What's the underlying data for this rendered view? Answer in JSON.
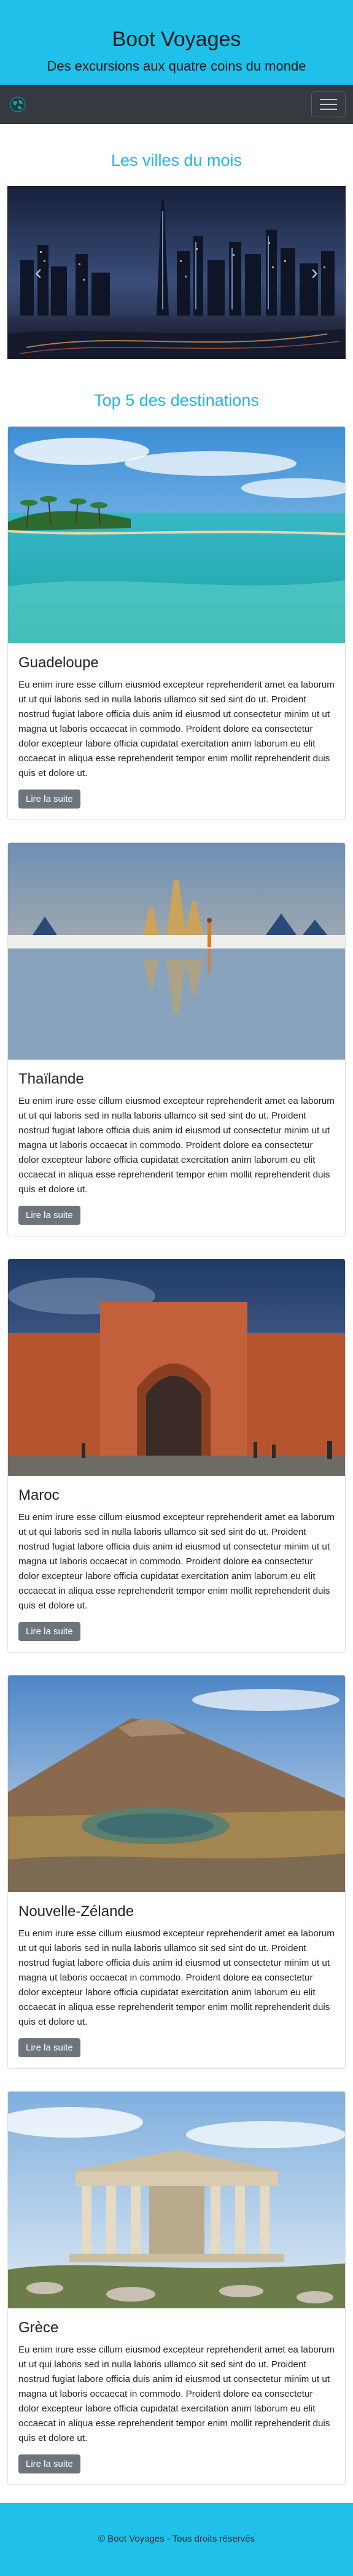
{
  "header": {
    "title": "Boot Voyages",
    "subtitle": "Des excursions aux quatre coins du monde"
  },
  "nav": {
    "brand_icon": "globe-icon",
    "toggler_icon": "hamburger-icon"
  },
  "carousel": {
    "title": "Les villes du mois",
    "prev_icon": "chevron-left-icon",
    "next_icon": "chevron-right-icon",
    "prev_glyph": "‹",
    "next_glyph": "›"
  },
  "destinations": {
    "title": "Top 5 des destinations",
    "items": [
      {
        "name": "Guadeloupe",
        "text": "Eu enim irure esse cillum eiusmod excepteur reprehenderit amet ea laborum ut ut qui laboris sed in nulla laboris ullamco sit sed sint do ut. Proident nostrud fugiat labore officia duis anim id eiusmod ut consectetur minim ut ut magna ut laboris occaecat in commodo. Proident dolore ea consectetur dolor excepteur labore officia cupidatat exercitation anim laborum eu elit occaecat in aliqua esse reprehenderit tempor enim mollit reprehenderit duis quis et dolore ut.",
        "button": "Lire la suite"
      },
      {
        "name": "Thaïlande",
        "text": "Eu enim irure esse cillum eiusmod excepteur reprehenderit amet ea laborum ut ut qui laboris sed in nulla laboris ullamco sit sed sint do ut. Proident nostrud fugiat labore officia duis anim id eiusmod ut consectetur minim ut ut magna ut laboris occaecat in commodo. Proident dolore ea consectetur dolor excepteur labore officia cupidatat exercitation anim laborum eu elit occaecat in aliqua esse reprehenderit tempor enim mollit reprehenderit duis quis et dolore ut.",
        "button": "Lire la suite"
      },
      {
        "name": "Maroc",
        "text": "Eu enim irure esse cillum eiusmod excepteur reprehenderit amet ea laborum ut ut qui laboris sed in nulla laboris ullamco sit sed sint do ut. Proident nostrud fugiat labore officia duis anim id eiusmod ut consectetur minim ut ut magna ut laboris occaecat in commodo. Proident dolore ea consectetur dolor excepteur labore officia cupidatat exercitation anim laborum eu elit occaecat in aliqua esse reprehenderit tempor enim mollit reprehenderit duis quis et dolore ut.",
        "button": "Lire la suite"
      },
      {
        "name": "Nouvelle-Zélande",
        "text": "Eu enim irure esse cillum eiusmod excepteur reprehenderit amet ea laborum ut ut qui laboris sed in nulla laboris ullamco sit sed sint do ut. Proident nostrud fugiat labore officia duis anim id eiusmod ut consectetur minim ut ut magna ut laboris occaecat in commodo. Proident dolore ea consectetur dolor excepteur labore officia cupidatat exercitation anim laborum eu elit occaecat in aliqua esse reprehenderit tempor enim mollit reprehenderit duis quis et dolore ut.",
        "button": "Lire la suite"
      },
      {
        "name": "Grèce",
        "text": "Eu enim irure esse cillum eiusmod excepteur reprehenderit amet ea laborum ut ut qui laboris sed in nulla laboris ullamco sit sed sint do ut. Proident nostrud fugiat labore officia duis anim id eiusmod ut consectetur minim ut ut magna ut laboris occaecat in commodo. Proident dolore ea consectetur dolor excepteur labore officia cupidatat exercitation anim laborum eu elit occaecat in aliqua esse reprehenderit tempor enim mollit reprehenderit duis quis et dolore ut.",
        "button": "Lire la suite"
      }
    ]
  },
  "footer": {
    "text": "© Boot Voyages - Tous droits réservés"
  },
  "colors": {
    "accent": "#1fc0ea",
    "heading": "#1fb6e6",
    "navbar": "#343a40",
    "button": "#6c757d"
  }
}
